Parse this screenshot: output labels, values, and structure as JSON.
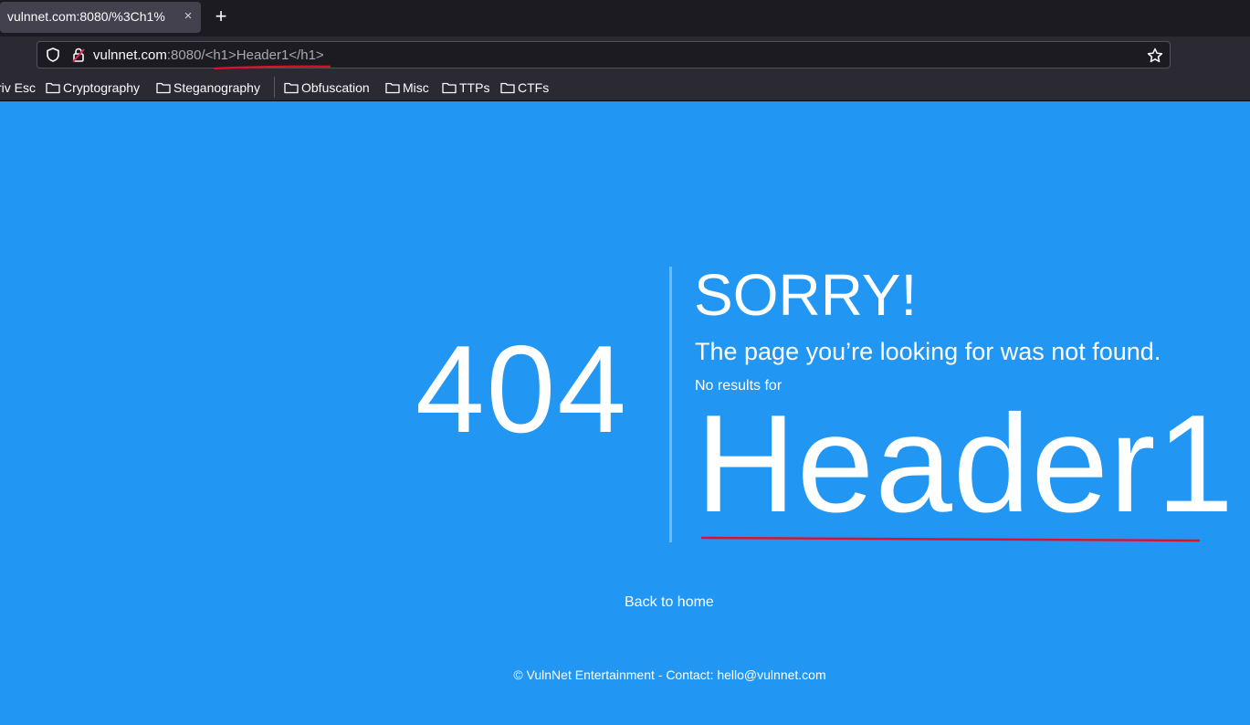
{
  "browser": {
    "tab_title": "vulnnet.com:8080/%3Ch1%",
    "tab_close": "×",
    "new_tab": "+",
    "url_host": "vulnnet.com",
    "url_rest": ":8080/<h1>Header1</h1>",
    "bookmarks": [
      {
        "label": "riv Esc",
        "folder": false
      },
      {
        "label": "Cryptography",
        "folder": true
      },
      {
        "label": "Steganography",
        "folder": true
      },
      {
        "label": "Obfuscation",
        "folder": true
      },
      {
        "label": "Misc",
        "folder": true
      },
      {
        "label": "TTPs",
        "folder": true
      },
      {
        "label": "CTFs",
        "folder": true
      }
    ]
  },
  "page": {
    "code": "404",
    "title": "SORRY!",
    "message": "The page you’re looking for was not found.",
    "no_results_label": "No results for",
    "injected_heading": "Header1",
    "back_link": "Back to home",
    "footer": "© VulnNet Entertainment - Contact: hello@vulnnet.com"
  },
  "colors": {
    "background": "#2196f3",
    "annotation": "#e0102a"
  }
}
